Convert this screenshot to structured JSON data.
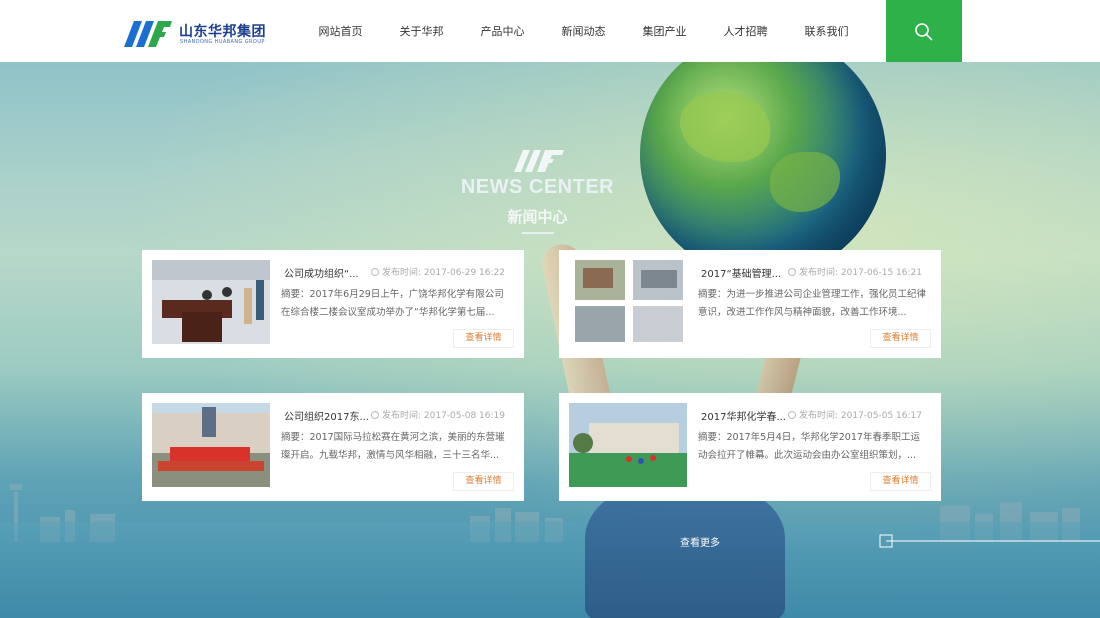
{
  "header": {
    "brand": "山东华邦集团",
    "brand_en": "SHANDONG HUABANG GROUP",
    "nav": [
      "网站首页",
      "关于华邦",
      "产品中心",
      "新闻动态",
      "集团产业",
      "人才招聘",
      "联系我们"
    ],
    "search_icon": "search-icon"
  },
  "section": {
    "title_en": "NEWS CENTER",
    "title_cn": "新闻中心"
  },
  "news": [
    {
      "title": "公司成功组织“...",
      "date_label": "发布时间:",
      "date": "2017-06-29 16:22",
      "summary": "摘要：2017年6月29日上午，广饶华邦化学有限公司在综合楼二楼会议室成功举办了“华邦化学第七届...",
      "more": "查看详情"
    },
    {
      "title": "2017“基础管理...",
      "date_label": "发布时间:",
      "date": "2017-06-15 16:21",
      "summary": "摘要：为进一步推进公司企业管理工作，强化员工纪律意识，改进工作作风与精神面貌，改善工作环境...",
      "more": "查看详情"
    },
    {
      "title": "公司组织2017东...",
      "date_label": "发布时间:",
      "date": "2017-05-08 16:19",
      "summary": "摘要：2017国际马拉松赛在黄河之滨，美丽的东营璀璨开启。九载华邦，激情与风华相融，三十三名华...",
      "more": "查看详情"
    },
    {
      "title": "2017华邦化学春...",
      "date_label": "发布时间:",
      "date": "2017-05-05 16:17",
      "summary": "摘要：2017年5月4日，华邦化学2017年春季职工运动会拉开了帷幕。此次运动会由办公室组织策划，...",
      "more": "查看详情"
    }
  ],
  "view_more": "查看更多"
}
